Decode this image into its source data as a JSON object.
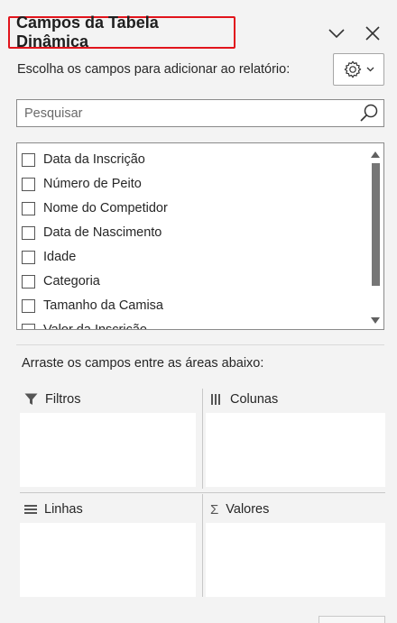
{
  "panel": {
    "title": "Campos da Tabela Dinâmica",
    "highlight_color": "#e1141c",
    "collapse_icon": "chevron-down-icon",
    "close_icon": "close-icon"
  },
  "choose_fields": {
    "label": "Escolha os campos para adicionar ao relatório:",
    "settings_icon": "gear-icon"
  },
  "search": {
    "placeholder": "Pesquisar",
    "value": "",
    "icon": "search-icon"
  },
  "fields": [
    {
      "label": "Data da Inscrição",
      "checked": false
    },
    {
      "label": "Número de Peito",
      "checked": false
    },
    {
      "label": "Nome do Competidor",
      "checked": false
    },
    {
      "label": "Data de Nascimento",
      "checked": false
    },
    {
      "label": "Idade",
      "checked": false
    },
    {
      "label": "Categoria",
      "checked": false
    },
    {
      "label": "Tamanho da Camisa",
      "checked": false
    },
    {
      "label": "Valor da Inscrição",
      "checked": false
    }
  ],
  "areas": {
    "instruction": "Arraste os campos entre as áreas abaixo:",
    "filters": {
      "label": "Filtros",
      "icon": "filter-icon"
    },
    "columns": {
      "label": "Colunas",
      "icon": "columns-icon"
    },
    "rows": {
      "label": "Linhas",
      "icon": "rows-icon"
    },
    "values": {
      "label": "Valores",
      "icon": "sigma-icon"
    }
  }
}
